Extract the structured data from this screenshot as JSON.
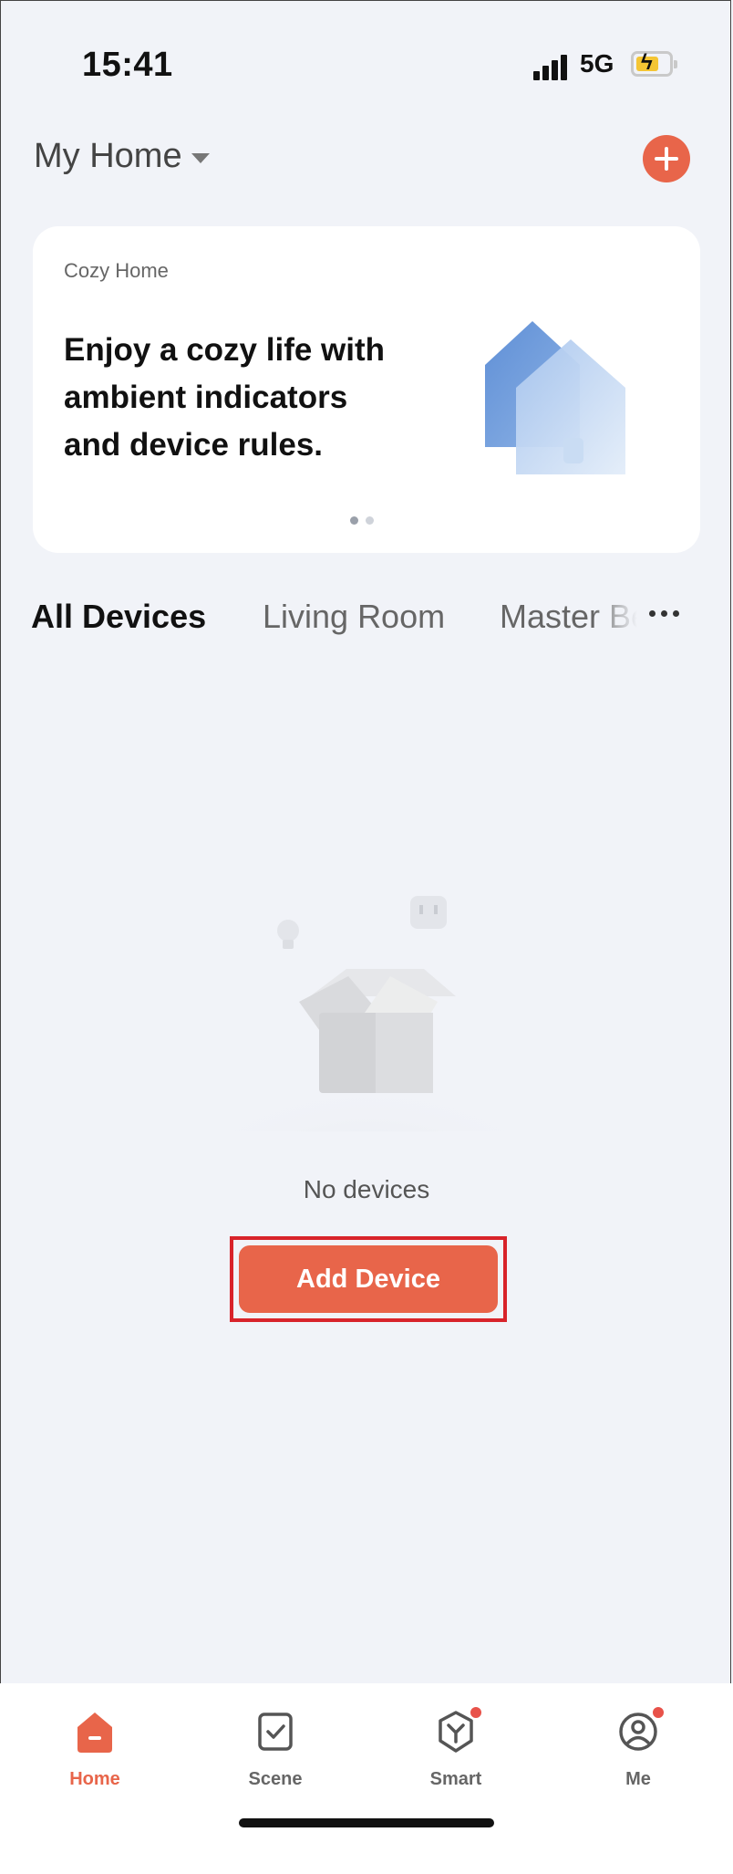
{
  "status_bar": {
    "time": "15:41",
    "network": "5G"
  },
  "header": {
    "home_name": "My Home"
  },
  "banner": {
    "kicker": "Cozy Home",
    "text": "Enjoy a cozy life with ambient indicators and device rules.",
    "page_count": 2,
    "active_page": 1
  },
  "room_tabs": [
    {
      "label": "All Devices",
      "active": true
    },
    {
      "label": "Living Room",
      "active": false
    },
    {
      "label": "Master Be",
      "active": false
    }
  ],
  "empty_state": {
    "message": "No devices",
    "button_label": "Add Device"
  },
  "tab_bar": {
    "items": [
      {
        "label": "Home",
        "icon": "home-icon",
        "active": true
      },
      {
        "label": "Scene",
        "icon": "scene-icon",
        "active": false
      },
      {
        "label": "Smart",
        "icon": "smart-icon",
        "active": false,
        "badge": true
      },
      {
        "label": "Me",
        "icon": "profile-icon",
        "active": false,
        "badge": true
      }
    ]
  },
  "colors": {
    "accent": "#e8654a",
    "highlight_box": "#d8232a",
    "background": "#f1f3f8"
  }
}
